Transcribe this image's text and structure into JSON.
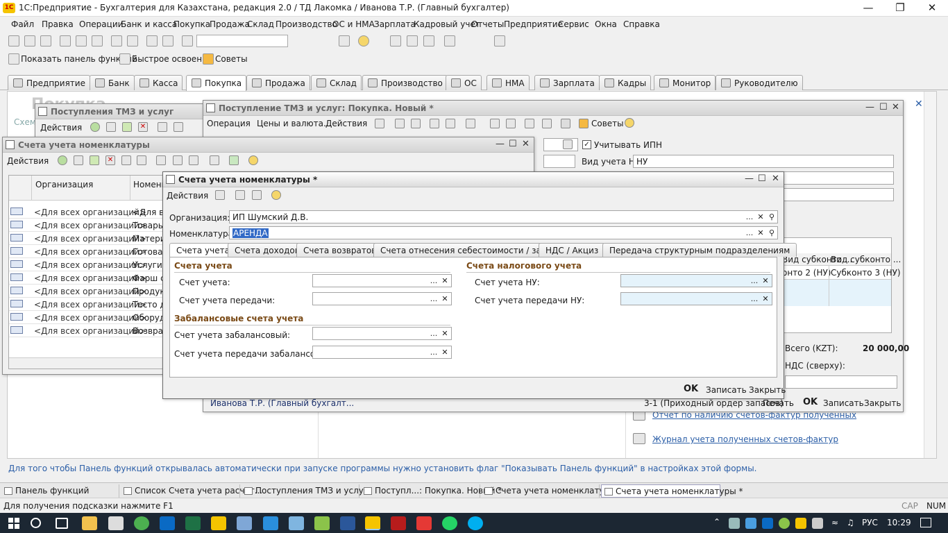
{
  "app": {
    "title": "1С:Предприятие - Бухгалтерия для Казахстана, редакция 2.0 / ТД Лакомка / Иванова Т.Р. (Главный бухгалтер)"
  },
  "menu": [
    "Файл",
    "Правка",
    "Операции",
    "Банк и касса",
    "Покупка",
    "Продажа",
    "Склад",
    "Производство",
    "ОС и НМА",
    "Зарплата",
    "Кадровый учет",
    "Отчеты",
    "Предприятие",
    "Сервис",
    "Окна",
    "Справка"
  ],
  "quickbar": {
    "panel": "Показать панель функций",
    "learn": "Быстрое освоение",
    "tips": "Советы"
  },
  "section_tabs": [
    "Предприятие",
    "Банк",
    "Касса",
    "Покупка",
    "Продажа",
    "Склад",
    "Производство",
    "ОС",
    "НМА",
    "Зарплата",
    "Кадры",
    "Монитор",
    "Руководителю"
  ],
  "bg_panel": {
    "title": "Покупка",
    "schema": "Схем",
    "link1": "Отчет по наличию счетов-фактур полученных",
    "link2": "Журнал учета полученных счетов-фактур",
    "hint": "Для того чтобы Панель функций открывалась автоматически при запуске программы нужно установить флаг \"Показывать Панель функций\" в настройках этой формы."
  },
  "win_list": {
    "title": "Поступления ТМЗ и услуг",
    "actions": "Действия"
  },
  "win_doc": {
    "title": "Поступление ТМЗ и услуг: Покупка. Новый *",
    "operation": "Операция",
    "prices": "Цены и валюта...",
    "actions": "Действия",
    "tips": "Советы",
    "ipn": "Учитывать ИПН",
    "vid_label": "Вид учета НУ:",
    "vid_value": "НУ",
    "col_s2": "Вид субконто ...",
    "col_s3": "Вид субконто ...",
    "sub2": "онто 2 (НУ)",
    "sub3": "Субконто 3 (НУ)",
    "total_label": "Всего (KZT):",
    "total_value": "20 000,00",
    "nds": "НДС (сверху):",
    "author": "Иванова Т.Р. (Главный бухгалт...",
    "order": "3-1 (Приходный ордер запасов)",
    "print": "Печать",
    "ok": "OK",
    "save": "Записать",
    "close": "Закрыть"
  },
  "win_accounts": {
    "title": "Счета учета номенклатуры",
    "actions": "Действия",
    "col_org": "Организация",
    "col_nom": "Номенк",
    "rows": [
      {
        "org": "<Для всех организаций>",
        "nom": "<Для в"
      },
      {
        "org": "<Для всех организаций>",
        "nom": "Товары"
      },
      {
        "org": "<Для всех организаций>",
        "nom": "Матери"
      },
      {
        "org": "<Для всех организаций>",
        "nom": "Готовая"
      },
      {
        "org": "<Для всех организаций>",
        "nom": "Услуги"
      },
      {
        "org": "<Для всех организаций>",
        "nom": "Фарш с"
      },
      {
        "org": "<Для всех организаций>",
        "nom": "Продук"
      },
      {
        "org": "<Для всех организаций>",
        "nom": "Тесто д"
      },
      {
        "org": "<Для всех организаций>",
        "nom": "Оборуд"
      },
      {
        "org": "<Для всех организаций>",
        "nom": "Возврат"
      }
    ]
  },
  "win_edit": {
    "title": "Счета учета номенклатуры *",
    "actions": "Действия",
    "org_label": "Организация:",
    "org_value": "ИП Шумский Д.В.",
    "nom_label": "Номенклатура:",
    "nom_value": "АРЕНДА",
    "tabs": [
      "Счета учета",
      "Счета доходов",
      "Счета возвратов",
      "Счета отнесения себестоимости / затрат",
      "НДС / Акциз",
      "Передача структурным подразделениям"
    ],
    "grp_acc": "Счета учета",
    "acc": "Счет учета:",
    "acc_transfer": "Счет учета передачи:",
    "grp_tax": "Счета налогового учета",
    "tax": "Счет учета НУ:",
    "tax_transfer": "Счет учета передачи НУ:",
    "grp_off": "Забалансовые счета учета",
    "off": "Счет учета забалансовый:",
    "off_transfer": "Счет учета передачи забалансовый:",
    "ok": "OK",
    "save": "Записать",
    "close": "Закрыть"
  },
  "taskstrip": [
    "Панель функций",
    "Список Счета учета расчет...",
    "Поступления ТМЗ и услуг",
    "Поступл...: Покупка. Новый *",
    "Счета учета номенклатуры",
    "Счета учета номенклатуры *"
  ],
  "status": {
    "hint": "Для получения подсказки нажмите F1",
    "cap": "CAP",
    "num": "NUM"
  },
  "taskbar": {
    "lang": "РУС",
    "time": "10:29"
  },
  "colors": {
    "workspace": "#ffffff",
    "accent_link": "#2b5ea7",
    "group_header": "#7a4a16",
    "taskbar": "#1c2733"
  }
}
